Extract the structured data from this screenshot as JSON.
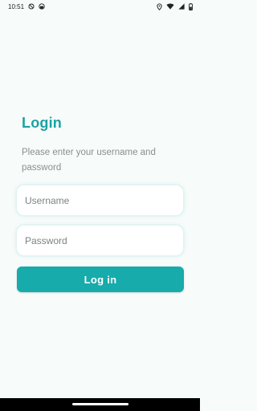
{
  "status_bar": {
    "time": "10:51",
    "icons_left": [
      "do-not-disturb-icon",
      "app-notification-icon"
    ],
    "icons_right": [
      "location-icon",
      "wifi-icon",
      "signal-icon",
      "battery-icon"
    ]
  },
  "login": {
    "title": "Login",
    "subtitle": "Please enter your username and password",
    "username_placeholder": "Username",
    "username_value": "",
    "password_placeholder": "Password",
    "password_value": "",
    "button_label": "Log in"
  },
  "colors": {
    "accent": "#17abab",
    "title": "#1aa3a3",
    "background": "#f7fbfa",
    "subtitle_text": "#8a8f8f"
  }
}
